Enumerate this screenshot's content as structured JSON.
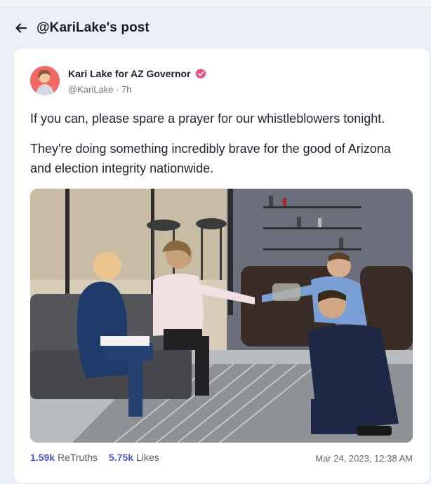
{
  "header": {
    "title": "@KariLake's post",
    "back_icon": "arrow-left-icon"
  },
  "post": {
    "author_name": "Kari Lake for AZ Governor",
    "verified_icon": "verified-badge-icon",
    "handle": "@KariLake",
    "age": "7h",
    "paragraphs": [
      "If you can, please spare a prayer for our whistleblowers tonight.",
      "They're doing something incredibly brave for the good of Arizona and election integrity nationwide."
    ],
    "retruths_count": "1.59k",
    "retruths_label": "ReTruths",
    "likes_count": "5.75k",
    "likes_label": "Likes",
    "timestamp": "Mar 24, 2023, 12:38 AM"
  },
  "colors": {
    "accent": "#4d56c9",
    "verified": "#e8527d",
    "background": "#eceef8"
  }
}
